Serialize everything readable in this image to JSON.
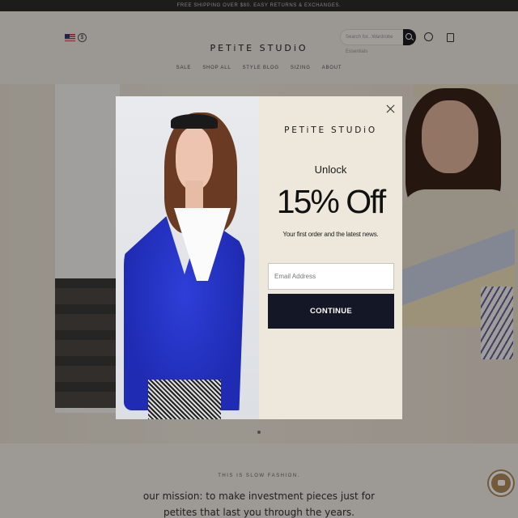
{
  "store": {
    "promo_text": "FREE SHIPPING OVER $80. EASY RETURNS & EXCHANGES.",
    "logo": "PETiTE STUDiO",
    "search_placeholder": "Search for...Wardrobe Essentials",
    "currency_symbol": "$",
    "nav_items": [
      "SALE",
      "SHOP ALL",
      "STYLE BLOG",
      "SIZING",
      "ABOUT"
    ],
    "mission_kicker": "THIS IS SLOW FASHION.",
    "mission_text": "our mission: to make investment pieces just for petites that last you through the years."
  },
  "popup": {
    "logo": "PETiTE STUDiO",
    "unlock": "Unlock",
    "headline": "15% Off",
    "subtext": "Your first order and the latest news.",
    "email_placeholder": "Email Address",
    "continue_label": "CONTINUE"
  },
  "colors": {
    "button_bg": "#141726",
    "model_sweater": "#2433c9",
    "modal_bg": "#ede7dc"
  }
}
